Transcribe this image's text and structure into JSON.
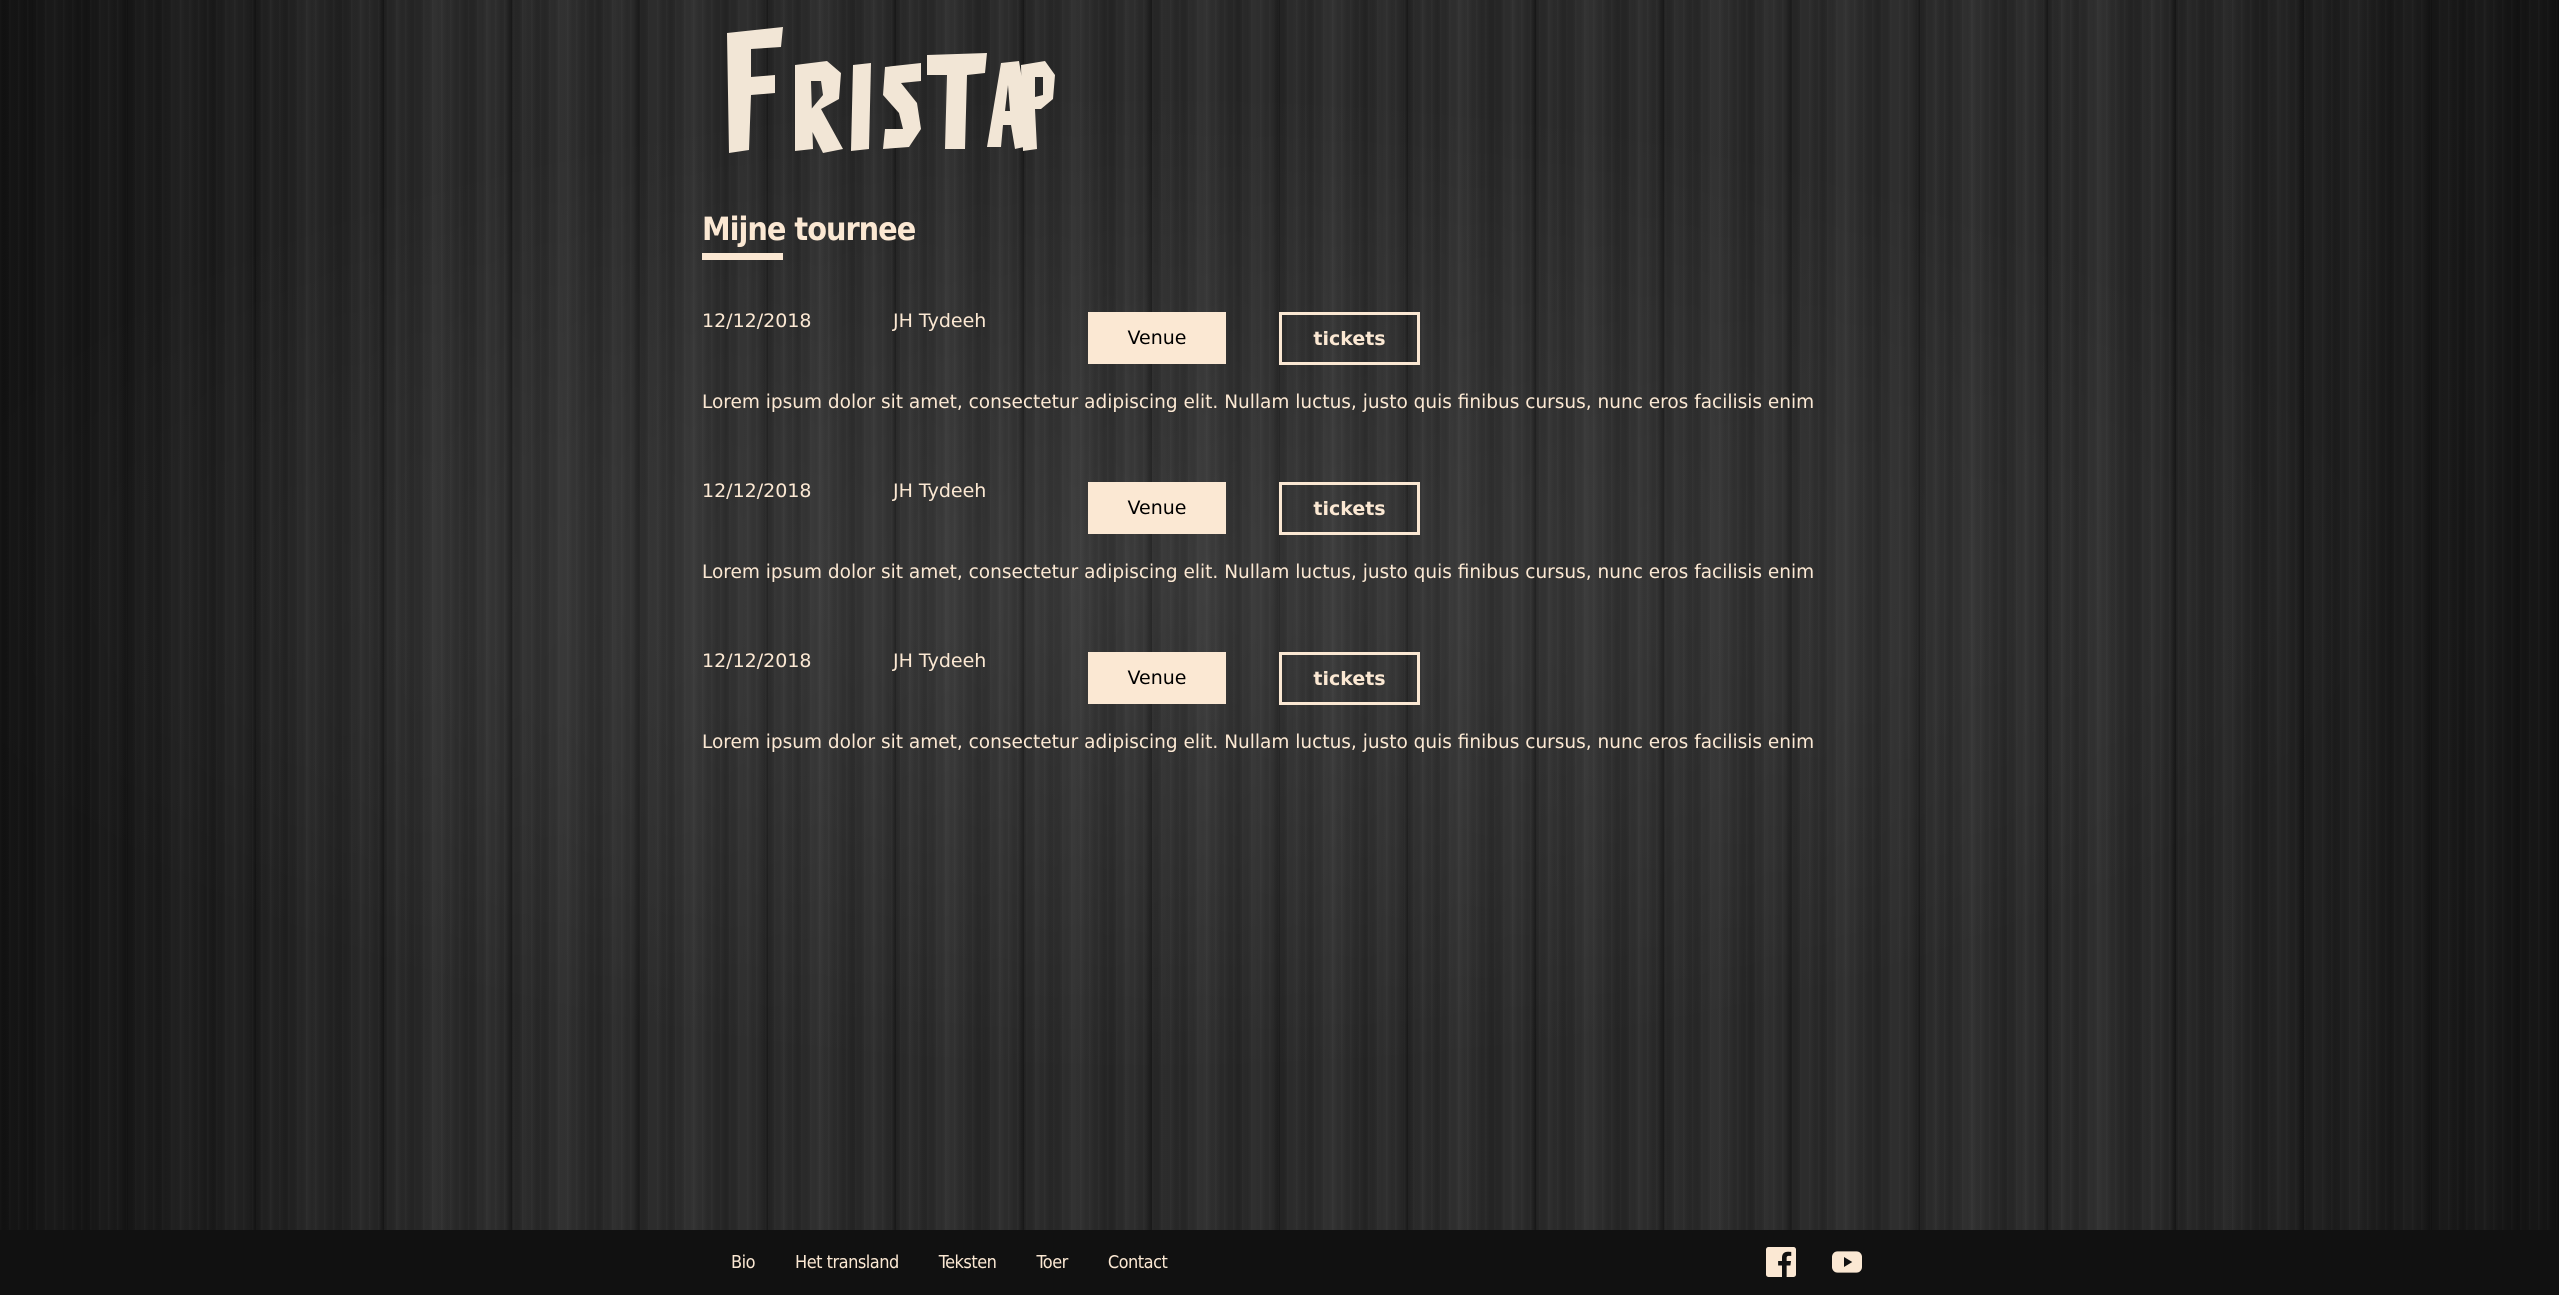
{
  "brand": {
    "logo_text": "FRISTAP"
  },
  "page": {
    "section_title": "Mijne tournee"
  },
  "tour": [
    {
      "date": "12/12/2018",
      "venue": "JH Tydeeh",
      "venue_button": "Venue",
      "tickets_button": "tickets",
      "description": "Lorem ipsum dolor sit amet, consectetur adipiscing elit. Nullam luctus, justo quis finibus cursus, nunc eros facilisis enim"
    },
    {
      "date": "12/12/2018",
      "venue": "JH Tydeeh",
      "venue_button": "Venue",
      "tickets_button": "tickets",
      "description": "Lorem ipsum dolor sit amet, consectetur adipiscing elit. Nullam luctus, justo quis finibus cursus, nunc eros facilisis enim"
    },
    {
      "date": "12/12/2018",
      "venue": "JH Tydeeh",
      "venue_button": "Venue",
      "tickets_button": "tickets",
      "description": "Lorem ipsum dolor sit amet, consectetur adipiscing elit. Nullam luctus, justo quis finibus cursus, nunc eros facilisis enim"
    }
  ],
  "footer": {
    "nav": [
      "Bio",
      "Het transland",
      "Teksten",
      "Toer",
      "Contact"
    ],
    "social_icons": [
      "facebook-icon",
      "youtube-icon"
    ]
  },
  "colors": {
    "accent": "#fbe8d3",
    "footer_bg": "#111111",
    "background": "#2a2a2a"
  }
}
